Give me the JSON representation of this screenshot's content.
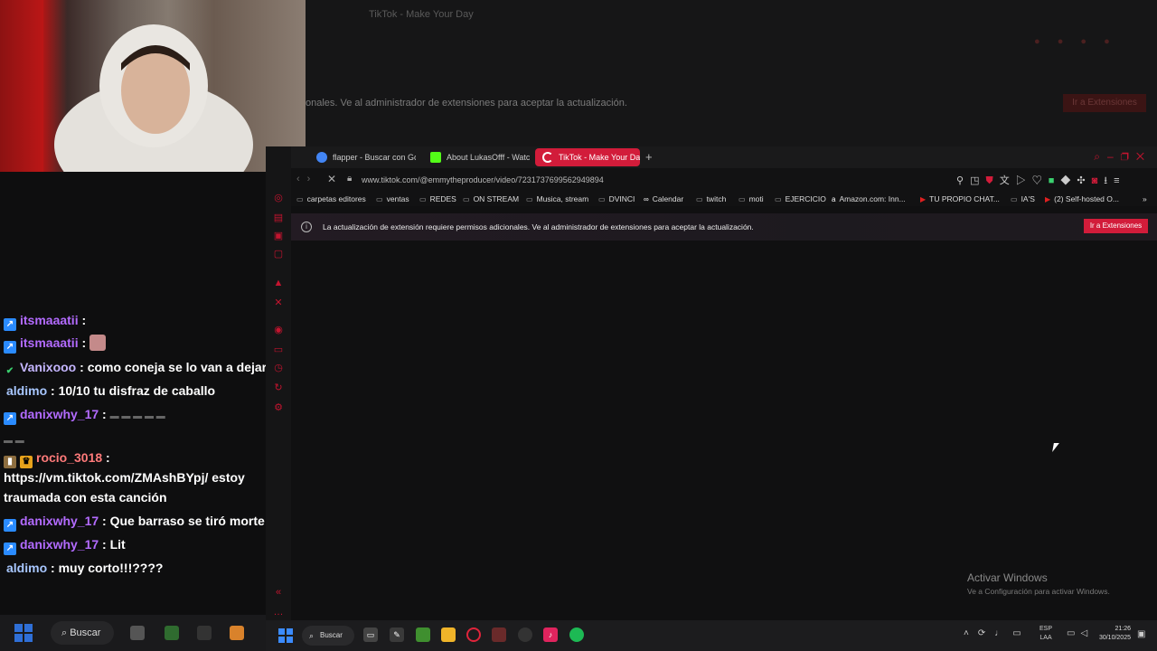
{
  "background_window": {
    "tab_title": "TikTok - Make Your Day",
    "notice": "onales. Ve al administrador de extensiones para aceptar la actualización.",
    "button": "Ir a Extensiones"
  },
  "chat": [
    {
      "user": "itsmaaatii",
      "color": "#b36bff",
      "badge": "prime",
      "message": ""
    },
    {
      "user": "itsmaaatii",
      "color": "#b36bff",
      "badge": "prime",
      "message": "",
      "emote": true
    },
    {
      "user": "Vanixooo",
      "color": "#c5b6ff",
      "badge": "check",
      "message": "como coneja se lo van a dejar"
    },
    {
      "user": "aldimo",
      "color": "#a8c7ff",
      "badge": "",
      "message": "10/10 tu disfraz de caballo"
    },
    {
      "user": "danixwhy_17",
      "color": "#b36bff",
      "badge": "prime",
      "message": ""
    },
    {
      "user": "rocio_3018",
      "color": "#ff7a7a",
      "badge": "crown",
      "message": ""
    },
    {
      "user": "",
      "color": "#ffffff",
      "badge": "",
      "message": "https://vm.tiktok.com/ZMAshBYpj/ estoy"
    },
    {
      "user": "",
      "color": "#ffffff",
      "badge": "",
      "message": "traumada con esta canción"
    },
    {
      "user": "danixwhy_17",
      "color": "#b36bff",
      "badge": "prime",
      "message": "Que barraso se tiró morte"
    },
    {
      "user": "danixwhy_17",
      "color": "#b36bff",
      "badge": "prime",
      "message": "Lit"
    },
    {
      "user": "aldimo",
      "color": "#a8c7ff",
      "badge": "",
      "message": "muy corto!!!????"
    }
  ],
  "browser": {
    "tabs": [
      {
        "title": "flapper - Buscar con Goo",
        "favicon_color": "#4285f4"
      },
      {
        "title": "About LukasOfff - Watch",
        "favicon_color": "#53fc18"
      },
      {
        "title": "TikTok - Make Your Day",
        "favicon_color": "#ffffff"
      }
    ],
    "new_tab": "+",
    "url": "www.tiktok.com/@emmytheproducer/video/7231737699562949894",
    "bookmarks": [
      {
        "label": "carpetas editores",
        "icon": "folder-icon"
      },
      {
        "label": "ventas",
        "icon": "folder-icon"
      },
      {
        "label": "REDES",
        "icon": "folder-icon"
      },
      {
        "label": "ON STREAM",
        "icon": "folder-icon"
      },
      {
        "label": "Musica, stream",
        "icon": "folder-icon"
      },
      {
        "label": "DVINCI",
        "icon": "folder-icon"
      },
      {
        "label": "Calendar",
        "icon": "infinity-icon"
      },
      {
        "label": "twitch",
        "icon": "folder-icon"
      },
      {
        "label": "moti",
        "icon": "folder-icon"
      },
      {
        "label": "EJERCICIO",
        "icon": "folder-icon"
      },
      {
        "label": "Amazon.com: Inn...",
        "icon": "amazon-icon"
      },
      {
        "label": "TU PROPIO CHAT...",
        "icon": "youtube-icon"
      },
      {
        "label": "IA'S",
        "icon": "folder-icon"
      },
      {
        "label": "(2) Self-hosted O...",
        "icon": "youtube-icon"
      }
    ],
    "notice_text": "La actualización de extensión requiere permisos adicionales. Ve al administrador de extensiones para aceptar la actualización.",
    "notice_button": "Ir a Extensiones"
  },
  "activate_windows": {
    "title": "Activar Windows",
    "subtitle": "Ve a Configuración para activar Windows."
  },
  "taskbar_left": {
    "search_label": "Buscar"
  },
  "taskbar": {
    "search_label": "Buscar",
    "lang_top": "ESP",
    "lang_bottom": "LAA",
    "time": "21:26",
    "date": "30/10/2025"
  }
}
